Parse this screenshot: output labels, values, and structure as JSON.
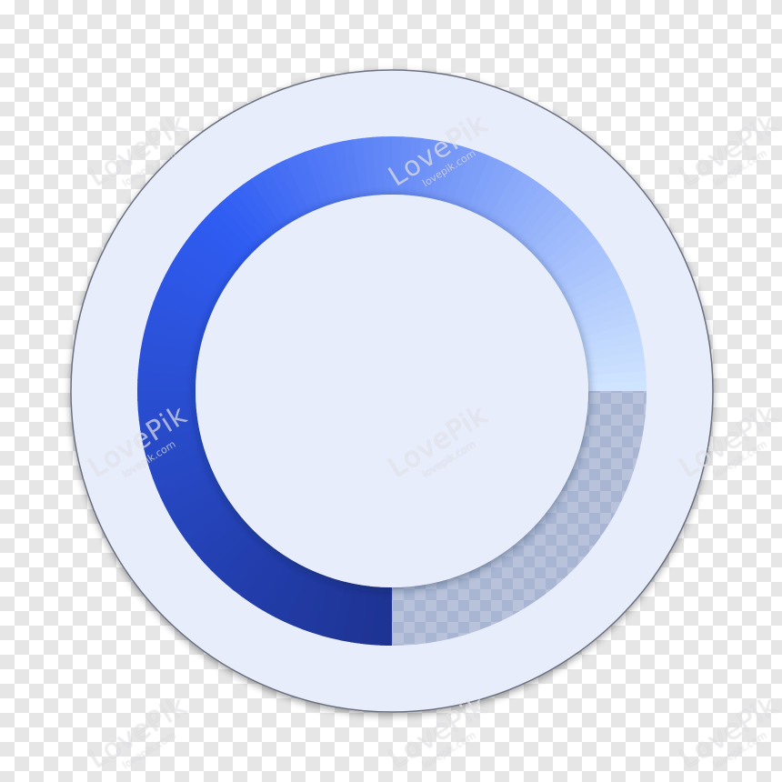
{
  "progress_ring": {
    "progress_percent": 75,
    "start_position": "bottom-center",
    "direction": "clockwise"
  },
  "colors": {
    "outer_disc": "#e8edfc",
    "inner_disc": "#e8edfc",
    "disc_edge": "#6b6f80",
    "ring_gradient_start": "#1e3392",
    "ring_gradient_mid": "#2f5cf2",
    "ring_gradient_end": "#cfe4ff",
    "ring_track": "#a8b6d3"
  },
  "watermark": {
    "brand": "LovePik",
    "domain": "lovepik.com"
  }
}
